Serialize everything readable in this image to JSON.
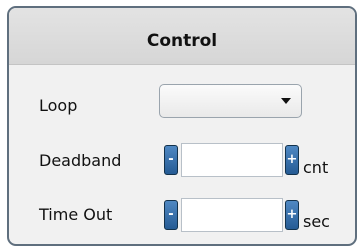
{
  "panel": {
    "title": "Control"
  },
  "loop": {
    "label": "Loop",
    "selected": ""
  },
  "deadband": {
    "label": "Deadband",
    "value": "",
    "unit": "cnt",
    "decrement": "-",
    "increment": "+"
  },
  "timeout": {
    "label": "Time Out",
    "value": "",
    "unit": "sec",
    "decrement": "-",
    "increment": "+"
  }
}
